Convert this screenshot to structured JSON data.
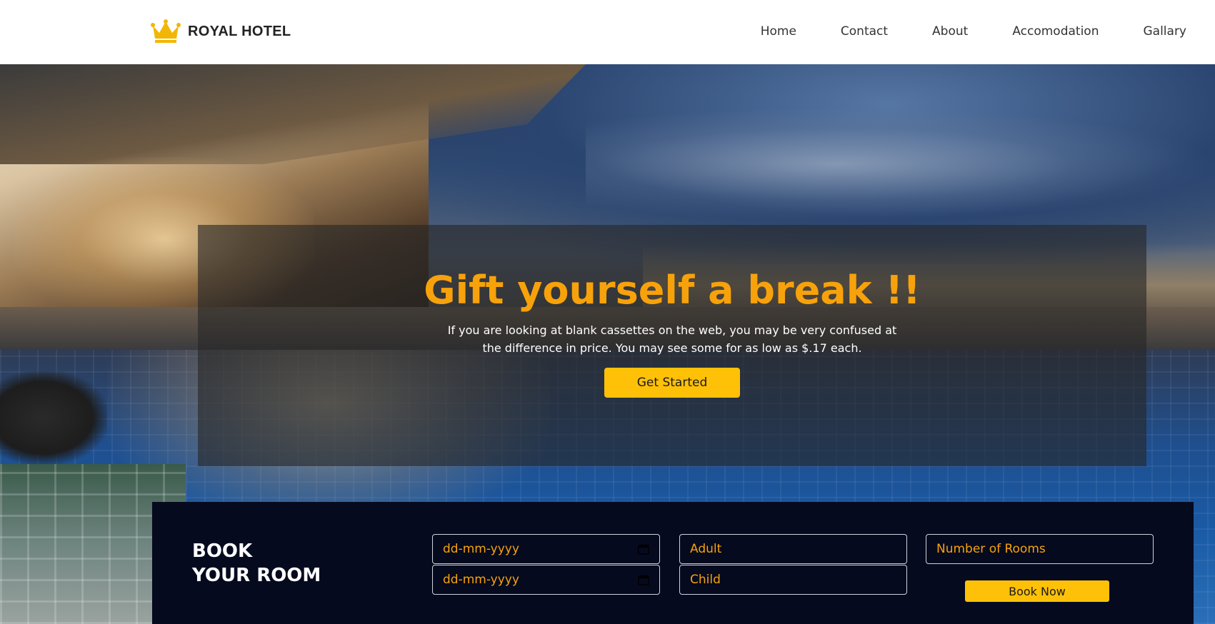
{
  "header": {
    "logo_text": "ROYAL HOTEL",
    "logo_icon": "crown-icon",
    "nav": [
      "Home",
      "Contact",
      "About",
      "Accomodation",
      "Gallary"
    ]
  },
  "hero": {
    "title": "Gift yourself a break !!",
    "description": "If you are looking at blank cassettes on the web, you may be very confused at the difference in price. You may see some for as low as $.17 each.",
    "cta_label": "Get Started"
  },
  "booking": {
    "title_line1": "BOOK",
    "title_line2": "YOUR ROOM",
    "arrival_date": "dd-mm-yyyy",
    "departure_date": "dd-mm-yyyy",
    "adult_placeholder": "Adult",
    "child_placeholder": "Child",
    "rooms_placeholder": "Number of Rooms",
    "submit_label": "Book Now"
  },
  "colors": {
    "accent": "#ffc107",
    "title_orange": "#f7a20b",
    "booking_bg": "#050a1e"
  }
}
